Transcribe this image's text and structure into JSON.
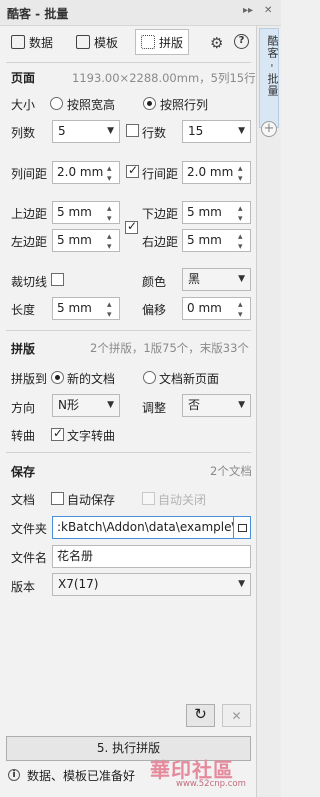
{
  "window": {
    "title": "酷客 - 批量",
    "pin_glyph": "▸▸",
    "close_glyph": "✕"
  },
  "tabs": {
    "data_label": "数据",
    "template_label": "模板",
    "imposition_label": "拼版"
  },
  "sidebar": {
    "tab_label": "酷客 - 批量",
    "add_glyph": "+"
  },
  "page_section": {
    "title": "页面",
    "info": "1193.00×2288.00mm，5列15行",
    "size_label": "大小",
    "size_options": [
      "按照宽高",
      "按照行列"
    ],
    "size_selected": "按照行列",
    "columns_label": "列数",
    "columns_value": "5",
    "rows_label": "行数",
    "rows_value": "15",
    "col_spacing_label": "列间距",
    "col_spacing_value": "2.0 mm",
    "row_spacing_label": "行间距",
    "row_spacing_value": "2.0 mm",
    "top_margin_label": "上边距",
    "top_margin_value": "5 mm",
    "bottom_margin_label": "下边距",
    "bottom_margin_value": "5 mm",
    "left_margin_label": "左边距",
    "left_margin_value": "5 mm",
    "right_margin_label": "右边距",
    "right_margin_value": "5 mm",
    "crop_marks_label": "裁切线",
    "color_label": "颜色",
    "color_value": "黑",
    "length_label": "长度",
    "length_value": "5 mm",
    "offset_label": "偏移",
    "offset_value": "0 mm"
  },
  "imposition_section": {
    "title": "拼版",
    "info": "2个拼版，1版75个，末版33个",
    "target_label": "拼版到",
    "target_options": [
      "新的文档",
      "文档新页面"
    ],
    "target_selected": "新的文档",
    "direction_label": "方向",
    "direction_value": "N形",
    "adjust_label": "调整",
    "adjust_value": "否",
    "rotate_label": "转曲",
    "rotate_text_label": "文字转曲"
  },
  "save_section": {
    "title": "保存",
    "info": "2个文档",
    "doc_label": "文档",
    "auto_save_label": "自动保存",
    "auto_close_label": "自动关闭",
    "folder_label": "文件夹",
    "folder_value": ":kBatch\\Addon\\data\\example\\",
    "filename_label": "文件名",
    "filename_value": "花名册",
    "version_label": "版本",
    "version_value": "X7(17)"
  },
  "actions": {
    "refresh_glyph": "↻",
    "cancel_glyph": "✕",
    "execute_label": "5. 执行拼版"
  },
  "status": {
    "icon_glyph": "i",
    "text": "数据、模板已准备好"
  },
  "watermark": {
    "text": "華印社區",
    "url": "www.52cnp.com"
  }
}
